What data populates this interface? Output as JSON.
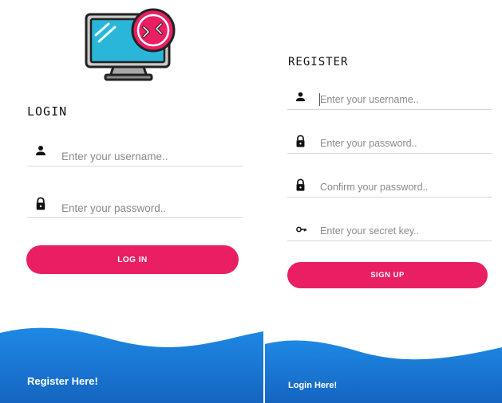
{
  "login": {
    "heading": "LOGIN",
    "username_placeholder": "Enter your username..",
    "password_placeholder": "Enter your password..",
    "button_label": "LOG IN",
    "footer_link": "Register Here!"
  },
  "register": {
    "heading": "REGISTER",
    "username_placeholder": "Enter your username..",
    "password_placeholder": "Enter your password..",
    "confirm_placeholder": "Confirm your password..",
    "secret_placeholder": "Enter your secret key..",
    "button_label": "SIGN UP",
    "footer_link": "Login Here!"
  },
  "icons": {
    "logo": "monitor-code-icon",
    "username": "person-icon",
    "password": "lock-icon",
    "confirm": "lock-icon",
    "secret": "key-icon"
  },
  "colors": {
    "accent": "#e91e63",
    "wave_top": "#1e88e5",
    "wave_bottom": "#1565c0",
    "monitor_screen": "#29b6d8"
  }
}
